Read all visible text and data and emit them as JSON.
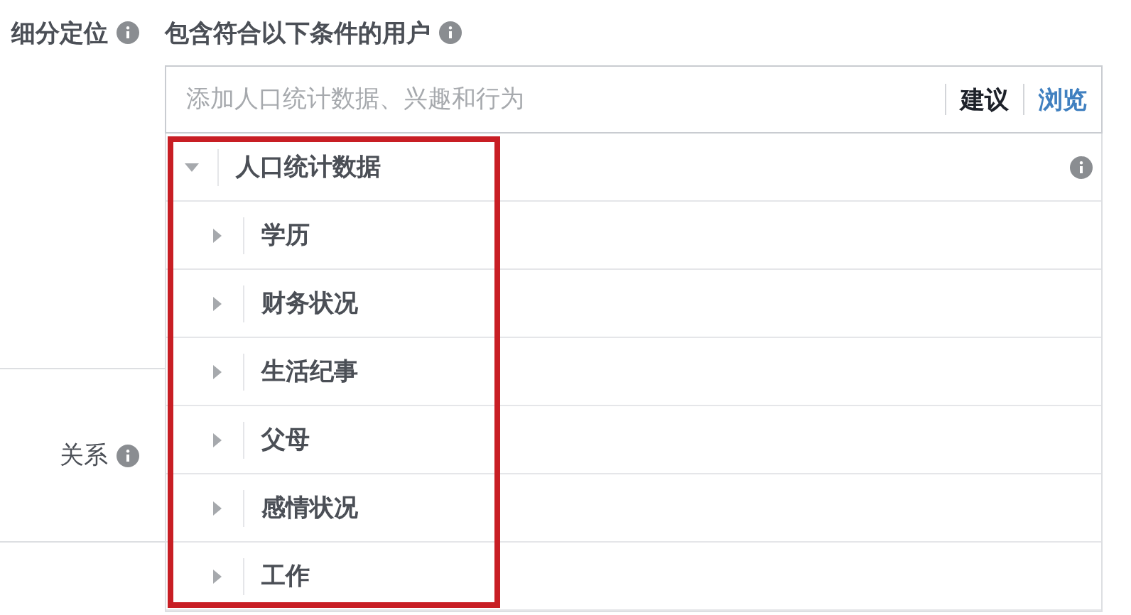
{
  "section_label": "细分定位",
  "criteria_label": "包含符合以下条件的用户",
  "search": {
    "placeholder": "添加人口统计数据、兴趣和行为"
  },
  "actions": [
    {
      "label": "建议",
      "selected": false
    },
    {
      "label": "浏览",
      "selected": true
    }
  ],
  "tree": [
    {
      "label": "人口统计数据",
      "expanded": true,
      "children": [
        {
          "label": "学历",
          "expanded": false
        },
        {
          "label": "财务状况",
          "expanded": false
        },
        {
          "label": "生活纪事",
          "expanded": false
        },
        {
          "label": "父母",
          "expanded": false
        },
        {
          "label": "感情状况",
          "expanded": false
        },
        {
          "label": "工作",
          "expanded": false
        }
      ]
    }
  ],
  "relationship_label": "关系"
}
